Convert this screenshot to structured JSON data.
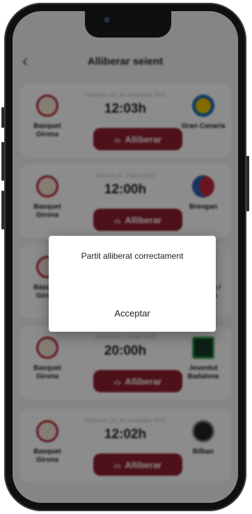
{
  "header": {
    "title": "Alliberar seient"
  },
  "matches": [
    {
      "home": "Basquet Girona",
      "away": "Gran Canaria",
      "date": "Dimecres 16, de novembre 2022",
      "time": "12:03h",
      "button": "Alliberar"
    },
    {
      "home": "Basquet Girona",
      "away": "Breogan",
      "date": "Dimarts 12, d'abril 2022",
      "time": "12:00h",
      "button": "Alliberar"
    },
    {
      "home": "Bàsquet Girona",
      "away": "Baskonia / Extremo",
      "date": "",
      "time": "",
      "button": ""
    },
    {
      "home": "Basquet Girona",
      "away": "Joventut Badalona",
      "date": "Dissabte 01, d'abril 2023",
      "time": "20:00h",
      "button": "Alliberar"
    },
    {
      "home": "Basquet Girona",
      "away": "Bilbao",
      "date": "Dimecres 16, de novembre 2022",
      "time": "12:02h",
      "button": "Alliberar"
    }
  ],
  "modal": {
    "message": "Partit alliberat correctament",
    "accept_label": "Acceptar"
  },
  "colors": {
    "accent": "#8e1f2e",
    "overlay": "rgba(0,0,0,0.45)"
  },
  "icons": {
    "back": "chevron-left-icon",
    "release": "seat-icon"
  }
}
